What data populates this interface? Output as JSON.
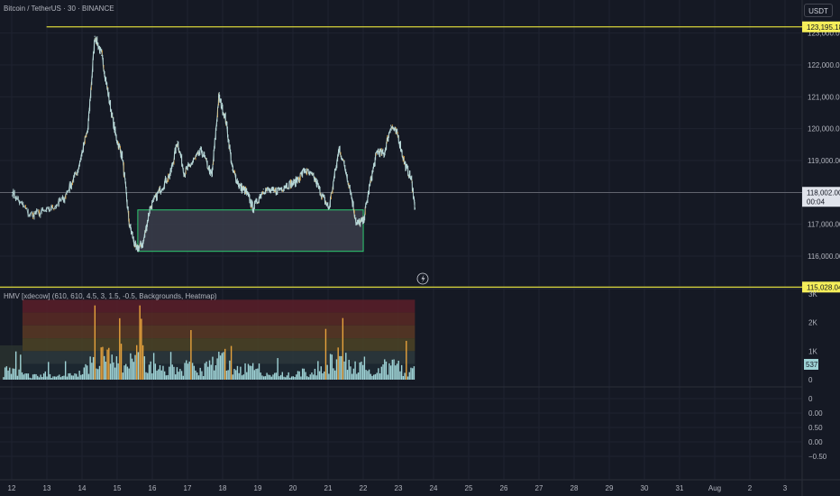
{
  "header": {
    "symbol_line": "Bitcoin / TetherUS · 30 · BINANCE",
    "currency": "USDT"
  },
  "indicator": {
    "title": "HMV [xdecow] (610, 610, 4.5, 3, 1.5, -0.5, Backgrounds, Heatmap)",
    "axis_ticks": [
      "3K",
      "2K",
      "1K",
      "0"
    ],
    "axis_values": [
      3000,
      2000,
      1000,
      0
    ],
    "last_volume": "537",
    "last_volume_value": 537
  },
  "oscillator": {
    "axis_ticks": [
      "0",
      "0.00",
      "0.50",
      "0.00",
      "−0.50"
    ],
    "axis_values": [
      1.0,
      0.75,
      0.5,
      0.25,
      0.0
    ]
  },
  "price_axis": {
    "ticks": [
      "122,000.00",
      "121,000.00",
      "120,000.00",
      "119,000.00",
      "117,000.00",
      "116,000.00"
    ],
    "tick_values": [
      122000,
      121000,
      120000,
      119000,
      117000,
      116000
    ],
    "partial_top": "123,000.00",
    "top_level_label": "123,195.18",
    "top_level_value": 123195.18,
    "bottom_level_label": "115,028.04",
    "bottom_level_value": 115028.04,
    "last_price_label": "118,002.00",
    "last_price_value": 118002,
    "countdown": "00:04"
  },
  "time_axis": {
    "labels": [
      "12",
      "13",
      "14",
      "15",
      "16",
      "17",
      "18",
      "19",
      "20",
      "21",
      "22",
      "23",
      "24",
      "25",
      "26",
      "27",
      "28",
      "29",
      "30",
      "31",
      "Aug",
      "2",
      "3"
    ]
  },
  "colors": {
    "background": "#151924",
    "level_line": "#d7d43a",
    "level_label_bg": "#f5ee5a",
    "candle": "#b8d8d8",
    "highlight": "#e6a23c",
    "zone_border": "#2ecc71",
    "zone_fill": "#3a3d4a",
    "last_price_label_bg": "#e0e3eb"
  },
  "chart_data": {
    "type": "line",
    "title": "Bitcoin / TetherUS · 30 · BINANCE",
    "xlabel": "",
    "ylabel": "",
    "x": [
      12,
      12.5,
      13,
      13.5,
      13.9,
      14.2,
      14.4,
      14.6,
      14.8,
      15.0,
      15.2,
      15.4,
      15.6,
      15.8,
      16.0,
      16.3,
      16.6,
      16.8,
      17.0,
      17.2,
      17.5,
      17.8,
      18.0,
      18.2,
      18.4,
      18.6,
      18.8,
      19.0,
      19.3,
      19.6,
      19.9,
      20.2,
      20.5,
      20.8,
      21.0,
      21.2,
      21.5,
      21.8,
      22.0,
      22.2,
      22.4,
      22.6,
      22.8,
      23.0,
      23.2,
      23.4,
      23.6,
      23.7
    ],
    "series": [
      {
        "values": [
          118000,
          117300,
          117400,
          117800,
          118700,
          120000,
          122900,
          122300,
          121000,
          119800,
          119100,
          117000,
          116200,
          116400,
          117500,
          118100,
          118600,
          119600,
          118600,
          118900,
          119300,
          118500,
          121000,
          120300,
          118700,
          118200,
          118000,
          117500,
          118100,
          118000,
          118200,
          118300,
          118700,
          118400,
          117900,
          117500,
          119400,
          118200,
          117000,
          117100,
          118300,
          119300,
          119200,
          120100,
          119800,
          118900,
          118400,
          117500
        ]
      }
    ],
    "ylim": [
      115028.04,
      123195.18
    ],
    "xlim": [
      11.7,
      23.9
    ],
    "levels": [
      123195.18,
      115028.04
    ],
    "last_price": 118002,
    "zone": {
      "x": [
        15.65,
        22.2
      ],
      "y": [
        116150,
        117450
      ]
    },
    "volume_x": [
      12,
      12.5,
      13,
      13.5,
      14,
      14.3,
      14.6,
      15.0,
      15.4,
      15.7,
      16.0,
      16.5,
      17.0,
      17.5,
      18.0,
      18.5,
      19.0,
      19.5,
      20.0,
      20.5,
      21.0,
      21.5,
      22.0,
      22.5,
      23.0,
      23.4,
      23.7
    ],
    "volume": [
      600,
      250,
      300,
      250,
      400,
      1500,
      1800,
      1200,
      600,
      2000,
      800,
      500,
      900,
      600,
      1300,
      800,
      700,
      300,
      400,
      500,
      600,
      1600,
      900,
      400,
      1100,
      600,
      537
    ],
    "volume_ylim": [
      0,
      3000
    ],
    "grid": true
  }
}
